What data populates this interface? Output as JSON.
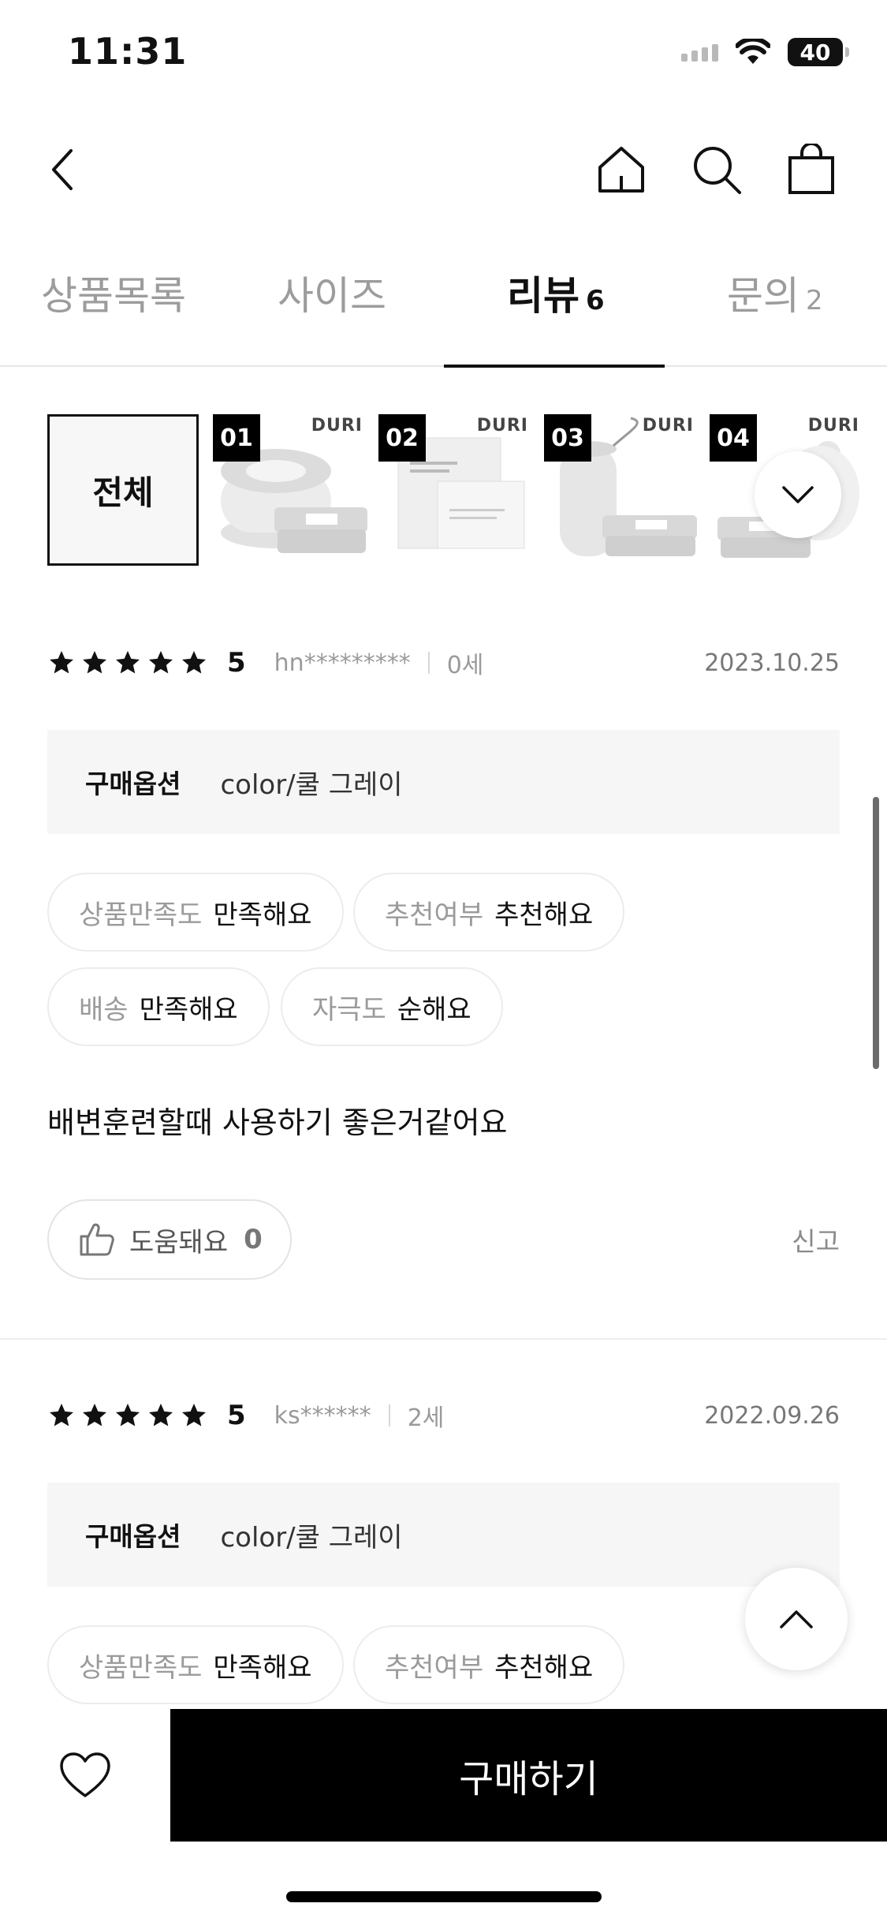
{
  "status": {
    "time": "11:31",
    "battery": "40"
  },
  "tabs": [
    {
      "label": "상품목록",
      "count": ""
    },
    {
      "label": "사이즈",
      "count": ""
    },
    {
      "label": "리뷰",
      "count": "6"
    },
    {
      "label": "문의",
      "count": "2"
    }
  ],
  "filters": {
    "all_label": "전체",
    "items": [
      {
        "num": "01",
        "brand": "DURI"
      },
      {
        "num": "02",
        "brand": "DURI"
      },
      {
        "num": "03",
        "brand": "DURI"
      },
      {
        "num": "04",
        "brand": "DURI"
      }
    ]
  },
  "reviews": [
    {
      "rating": "5",
      "reviewer": "hn*********",
      "age": "0세",
      "date": "2023.10.25",
      "option_label": "구매옵션",
      "option_value": "color/쿨 그레이",
      "chips": [
        {
          "key": "상품만족도",
          "value": "만족해요"
        },
        {
          "key": "추천여부",
          "value": "추천해요"
        },
        {
          "key": "배송",
          "value": "만족해요"
        },
        {
          "key": "자극도",
          "value": "순해요"
        }
      ],
      "text": "배변훈련할때 사용하기 좋은거같어요",
      "helpful_label": "도움돼요",
      "helpful_count": "0",
      "report_label": "신고"
    },
    {
      "rating": "5",
      "reviewer": "ks******",
      "age": "2세",
      "date": "2022.09.26",
      "option_label": "구매옵션",
      "option_value": "color/쿨 그레이",
      "chips": [
        {
          "key": "상품만족도",
          "value": "만족해요"
        },
        {
          "key": "추천여부",
          "value": "추천해요"
        }
      ]
    }
  ],
  "bottom": {
    "buy_label": "구매하기"
  }
}
